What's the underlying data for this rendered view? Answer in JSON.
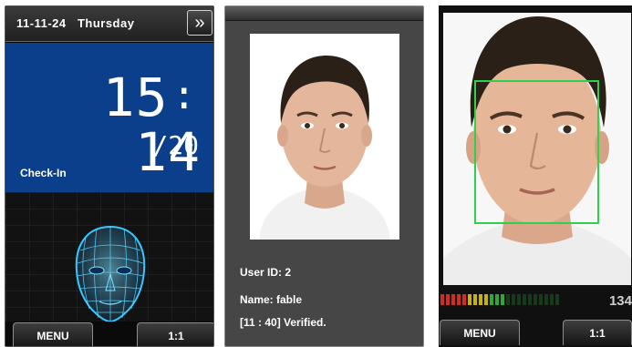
{
  "panel1": {
    "datetime": "11-11-24   Thursday",
    "next_icon": "double-chevron-right",
    "clock_hh": "15",
    "clock_mm": "14",
    "clock_sub": "/20",
    "status": "Check-In",
    "face_icon": "wireframe-head-icon",
    "menu_label": "MENU",
    "mode_label": "1:1"
  },
  "panel2": {
    "user_id": "User ID: 2",
    "name": "Name: fable",
    "verified": "[11 : 40] Verified."
  },
  "panel3": {
    "score": "134",
    "menu_label": "MENU",
    "mode_label": "1:1",
    "meter_level": 0.55
  },
  "colors": {
    "blue_area": "#0b3f8c",
    "face_glow": "#39c6ff",
    "detect_box": "#30d04a",
    "meter_red": "#d42b1f",
    "meter_yellow": "#c8b400",
    "meter_green": "#2fa63a"
  }
}
